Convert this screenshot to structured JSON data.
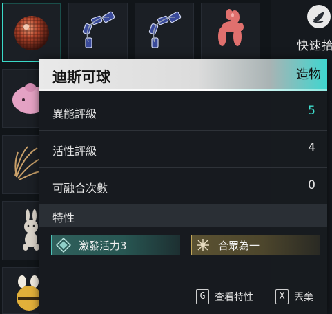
{
  "colors": {
    "accent": "#3fe0cf",
    "trait_cyan": "#285753",
    "trait_gold": "#4d462c"
  },
  "quick_pick": {
    "icon": "leaf-hand-icon",
    "label": "快速拾"
  },
  "inventory": {
    "slots": [
      {
        "icon": "disco-ball-icon",
        "selected": true
      },
      {
        "icon": "chain-link-icon",
        "selected": false
      },
      {
        "icon": "chain-link-icon",
        "selected": false
      },
      {
        "icon": "balloon-dog-icon",
        "selected": false
      },
      {
        "icon": "pink-creature-icon",
        "selected": false
      },
      {
        "icon": "feather-bundle-icon",
        "selected": false
      },
      {
        "icon": "bunny-plush-icon",
        "selected": false
      },
      {
        "icon": "bee-plush-icon",
        "selected": false
      }
    ]
  },
  "tooltip": {
    "name": "迪斯可球",
    "tag": "造物",
    "stats": [
      {
        "label": "異能評級",
        "value": "5"
      },
      {
        "label": "活性評級",
        "value": "4"
      },
      {
        "label": "可融合次數",
        "value": "0"
      }
    ],
    "traits_title": "特性",
    "traits": [
      {
        "label": "激發活力3",
        "icon": "diamond-trait-icon"
      },
      {
        "label": "合眾為一",
        "icon": "star-burst-trait-icon"
      }
    ],
    "hints": [
      {
        "key": "G",
        "label": "查看特性"
      },
      {
        "key": "X",
        "label": "丟棄"
      }
    ]
  }
}
